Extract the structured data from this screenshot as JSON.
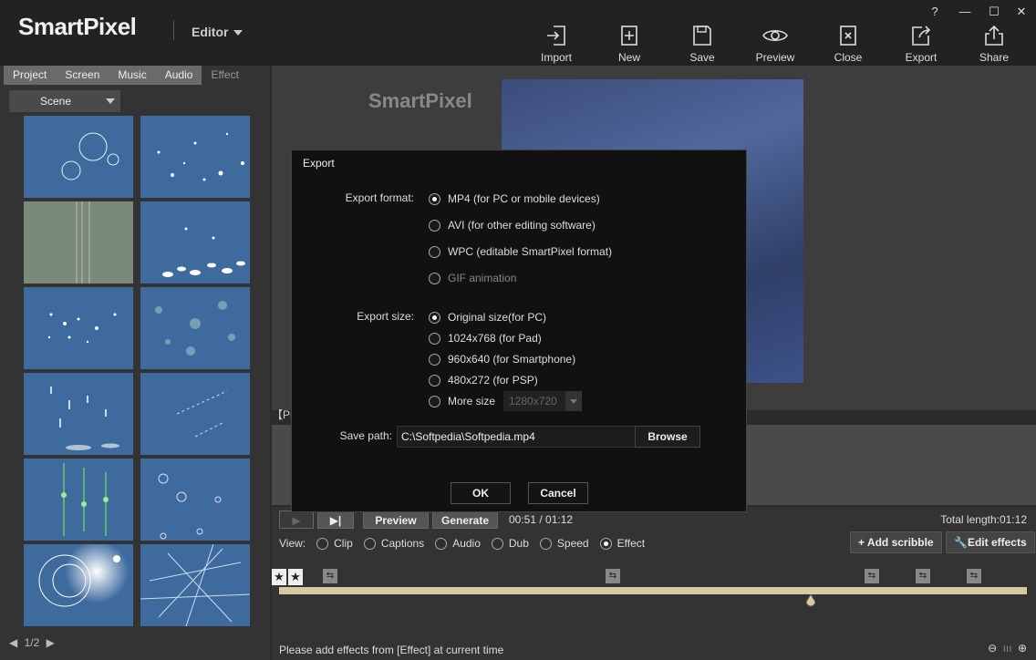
{
  "app": {
    "logo": "SmartPixel",
    "mode_menu": "Editor"
  },
  "window_controls": [
    "?",
    "—",
    "☐",
    "✕"
  ],
  "toolbar": [
    {
      "label": "Import",
      "icon": "import-icon"
    },
    {
      "label": "New",
      "icon": "new-icon"
    },
    {
      "label": "Save",
      "icon": "save-icon"
    },
    {
      "label": "Preview",
      "icon": "eye-icon"
    },
    {
      "label": "Close",
      "icon": "close-icon"
    },
    {
      "label": "Export",
      "icon": "export-icon"
    },
    {
      "label": "Share",
      "icon": "share-icon"
    }
  ],
  "left_tabs": [
    {
      "label": "Project"
    },
    {
      "label": "Screen"
    },
    {
      "label": "Music"
    },
    {
      "label": "Audio"
    },
    {
      "label": "Effect"
    }
  ],
  "scene_select": "Scene",
  "pager": "1/2",
  "preview": {
    "watermark_logo": "SmartPixel"
  },
  "project_material_label": "【Project material】",
  "controls": {
    "preview_btn": "Preview",
    "generate_btn": "Generate",
    "timecode": "00:51 / 01:12",
    "total_length": "Total length:01:12",
    "view_label": "View:",
    "view_options": [
      {
        "label": "Clip",
        "selected": false
      },
      {
        "label": "Captions",
        "selected": false
      },
      {
        "label": "Audio",
        "selected": false
      },
      {
        "label": "Dub",
        "selected": false
      },
      {
        "label": "Speed",
        "selected": false
      },
      {
        "label": "Effect",
        "selected": true
      }
    ],
    "add_scribble": "Add scribble",
    "edit_effects": "Edit effects",
    "status": "Please add effects from [Effect] at current time"
  },
  "dialog": {
    "title": "Export",
    "format_label": "Export format:",
    "formats": [
      {
        "label": "MP4 (for PC or mobile devices)",
        "selected": true,
        "disabled": false
      },
      {
        "label": "AVI (for other editing software)",
        "selected": false,
        "disabled": false
      },
      {
        "label": "WPC (editable SmartPixel format)",
        "selected": false,
        "disabled": false
      },
      {
        "label": "GIF animation",
        "selected": false,
        "disabled": true
      }
    ],
    "size_label": "Export size:",
    "sizes": [
      {
        "label": "Original size(for PC)",
        "selected": true
      },
      {
        "label": "1024x768 (for Pad)",
        "selected": false
      },
      {
        "label": "960x640 (for Smartphone)",
        "selected": false
      },
      {
        "label": "480x272 (for PSP)",
        "selected": false
      },
      {
        "label": "More size",
        "selected": false
      }
    ],
    "more_size_value": "1280x720",
    "save_path_label": "Save path:",
    "save_path": "C:\\Softpedia\\Softpedia.mp4",
    "browse": "Browse",
    "ok": "OK",
    "cancel": "Cancel"
  },
  "colors": {
    "accent_track": "#d8c9a3",
    "thumb_bg": "#3e6a9e"
  }
}
